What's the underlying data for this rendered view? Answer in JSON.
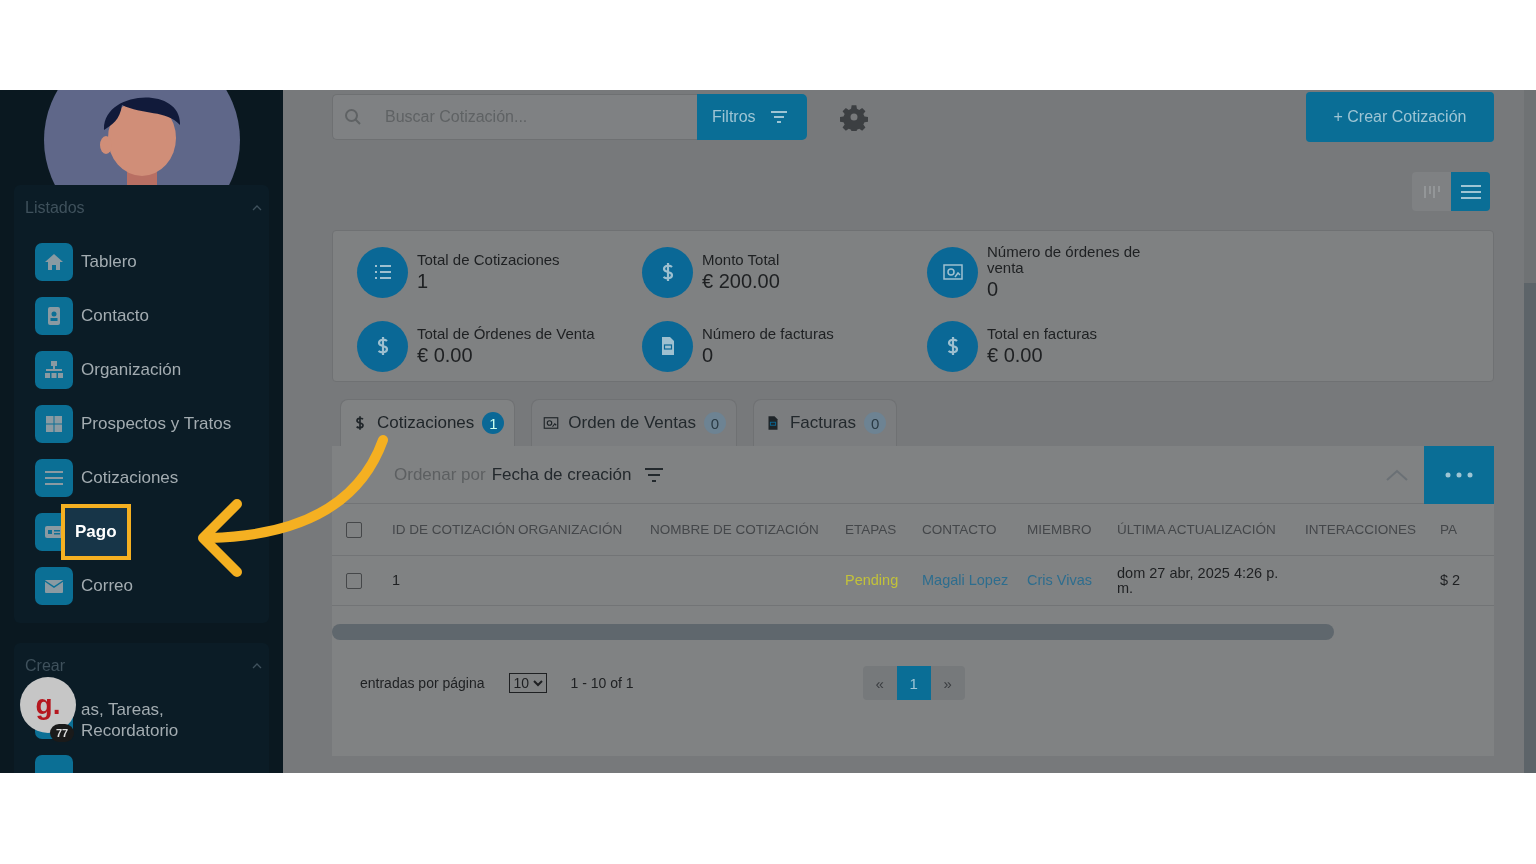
{
  "sidebar": {
    "sections": [
      {
        "title": "Listados",
        "expanded": true,
        "items": [
          {
            "label": "Tablero",
            "selected": false,
            "highlighted": false
          },
          {
            "label": "Contacto",
            "selected": false,
            "highlighted": false
          },
          {
            "label": "Organización",
            "selected": false,
            "highlighted": false
          },
          {
            "label": "Prospectos y Tratos",
            "selected": false,
            "highlighted": false
          },
          {
            "label": "Cotizaciones",
            "selected": false,
            "highlighted": false
          },
          {
            "label": "Pago",
            "selected": true,
            "highlighted": true
          },
          {
            "label": "Correo",
            "selected": false,
            "highlighted": false
          }
        ]
      },
      {
        "title": "Crear",
        "expanded": true,
        "items": [
          {
            "label": "as, Tareas, Recordatorio",
            "selected": false,
            "highlighted": false
          }
        ]
      }
    ]
  },
  "chat_widget": {
    "logo": "g.",
    "badge": "77"
  },
  "toolbar": {
    "search": {
      "placeholder": "Buscar Cotización..."
    },
    "filter_button": "Filtros",
    "create_button": "+ Crear Cotización",
    "view_toggle": [
      {
        "selected": false
      },
      {
        "selected": true
      }
    ]
  },
  "stats": [
    {
      "label": "Total de Cotizaciones",
      "value": "1"
    },
    {
      "label": "Monto Total",
      "value": "€ 200.00"
    },
    {
      "label": "Número de órdenes de venta",
      "value": "0"
    },
    {
      "label": "Total de Órdenes de Venta",
      "value": "€ 0.00"
    },
    {
      "label": "Número de facturas",
      "value": "0"
    },
    {
      "label": "Total en facturas",
      "value": "€ 0.00"
    }
  ],
  "tabs": [
    {
      "label": "Cotizaciones",
      "count": "1",
      "selected": true
    },
    {
      "label": "Orden de Ventas",
      "count": "0",
      "selected": false
    },
    {
      "label": "Facturas",
      "count": "0",
      "selected": false
    }
  ],
  "table": {
    "sort_label": "Ordenar por",
    "sort_field": "Fecha de creación",
    "header_checked": false,
    "columns": [
      "ID DE COTIZACIÓN",
      "ORGANIZACIÓN",
      "NOMBRE DE COTIZACIÓN",
      "ETAPAS",
      "CONTACTO",
      "MIEMBRO",
      "ÚLTIMA ACTUALIZACIÓN",
      "INTERACCIONES",
      "PA"
    ],
    "rows": [
      {
        "checked": false,
        "cells": [
          {
            "kind": "text",
            "text": "1"
          },
          {
            "kind": "text"
          },
          {
            "kind": "text"
          },
          {
            "kind": "status",
            "text": "Pending"
          },
          {
            "kind": "link",
            "text": "Magali Lopez"
          },
          {
            "kind": "link",
            "text": "Cris Vivas"
          },
          {
            "kind": "text",
            "text": "dom 27 abr, 2025 4:26 p. m."
          },
          {
            "kind": "text"
          },
          {
            "kind": "text",
            "text": "$ 2"
          }
        ]
      }
    ]
  },
  "pagination": {
    "per_page_label": "entradas por página",
    "per_page": "10",
    "range": "1 - 10 of 1",
    "pages": [
      {
        "label": "«",
        "selected": false
      },
      {
        "label": "1",
        "selected": true
      },
      {
        "label": "»",
        "selected": false
      }
    ]
  }
}
